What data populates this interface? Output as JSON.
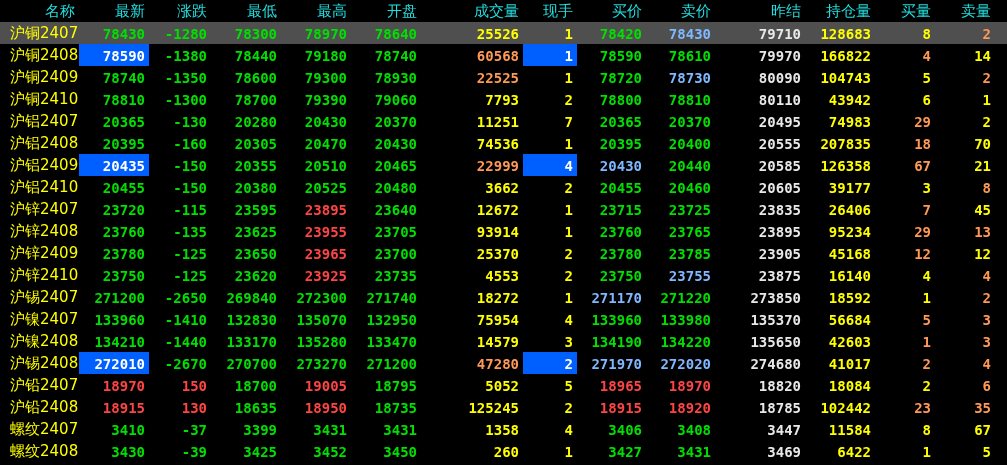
{
  "columns": [
    "名称",
    "最新",
    "涨跌",
    "最低",
    "最高",
    "开盘",
    "成交量",
    "现手",
    "买价",
    "卖价",
    "昨结",
    "持仓量",
    "买量",
    "卖量"
  ],
  "rows": [
    {
      "name": "沪铜2407",
      "selected": true,
      "flashed": false,
      "cells": [
        {
          "text": "78430",
          "color": "#00e000"
        },
        {
          "text": "-1280",
          "color": "#00e000"
        },
        {
          "text": "78300",
          "color": "#00e000"
        },
        {
          "text": "78970",
          "color": "#00e000"
        },
        {
          "text": "78640",
          "color": "#00e000"
        },
        {
          "text": "25526",
          "color": "#ffff00"
        },
        {
          "text": "1",
          "color": "#ffff00"
        },
        {
          "text": "78420",
          "color": "#00e000"
        },
        {
          "text": "78430",
          "color": "#80b8ff"
        },
        {
          "text": "79710",
          "color": "#e8e8e8"
        },
        {
          "text": "128683",
          "color": "#ffff00"
        },
        {
          "text": "8",
          "color": "#ffff00"
        },
        {
          "text": "2",
          "color": "#ff9955"
        }
      ]
    },
    {
      "name": "沪铜2408",
      "selected": false,
      "flashed": true,
      "cells": [
        {
          "text": "78590",
          "color": "#ffffff"
        },
        {
          "text": "-1380",
          "color": "#00e000"
        },
        {
          "text": "78440",
          "color": "#00e000"
        },
        {
          "text": "79180",
          "color": "#00e000"
        },
        {
          "text": "78740",
          "color": "#00e000"
        },
        {
          "text": "60568",
          "color": "#ff9955"
        },
        {
          "text": "1",
          "color": "#ffffff"
        },
        {
          "text": "78590",
          "color": "#00e000"
        },
        {
          "text": "78610",
          "color": "#00e000"
        },
        {
          "text": "79970",
          "color": "#e8e8e8"
        },
        {
          "text": "166822",
          "color": "#ffff00"
        },
        {
          "text": "4",
          "color": "#ff9955"
        },
        {
          "text": "14",
          "color": "#ffff00"
        }
      ]
    },
    {
      "name": "沪铜2409",
      "selected": false,
      "flashed": false,
      "cells": [
        {
          "text": "78740",
          "color": "#00e000"
        },
        {
          "text": "-1350",
          "color": "#00e000"
        },
        {
          "text": "78600",
          "color": "#00e000"
        },
        {
          "text": "79300",
          "color": "#00e000"
        },
        {
          "text": "78930",
          "color": "#00e000"
        },
        {
          "text": "22525",
          "color": "#ff9955"
        },
        {
          "text": "1",
          "color": "#ffff00"
        },
        {
          "text": "78720",
          "color": "#00e000"
        },
        {
          "text": "78730",
          "color": "#80b8ff"
        },
        {
          "text": "80090",
          "color": "#e8e8e8"
        },
        {
          "text": "104743",
          "color": "#ffff00"
        },
        {
          "text": "5",
          "color": "#ffff00"
        },
        {
          "text": "2",
          "color": "#ff9955"
        }
      ]
    },
    {
      "name": "沪铜2410",
      "selected": false,
      "flashed": false,
      "cells": [
        {
          "text": "78810",
          "color": "#00e000"
        },
        {
          "text": "-1300",
          "color": "#00e000"
        },
        {
          "text": "78700",
          "color": "#00e000"
        },
        {
          "text": "79390",
          "color": "#00e000"
        },
        {
          "text": "79060",
          "color": "#00e000"
        },
        {
          "text": "7793",
          "color": "#ffff00"
        },
        {
          "text": "2",
          "color": "#ffff00"
        },
        {
          "text": "78800",
          "color": "#00e000"
        },
        {
          "text": "78810",
          "color": "#00e000"
        },
        {
          "text": "80110",
          "color": "#e8e8e8"
        },
        {
          "text": "43942",
          "color": "#ffff00"
        },
        {
          "text": "6",
          "color": "#ffff00"
        },
        {
          "text": "1",
          "color": "#ffff00"
        }
      ]
    },
    {
      "name": "沪铝2407",
      "selected": false,
      "flashed": false,
      "cells": [
        {
          "text": "20365",
          "color": "#00e000"
        },
        {
          "text": "-130",
          "color": "#00e000"
        },
        {
          "text": "20280",
          "color": "#00e000"
        },
        {
          "text": "20430",
          "color": "#00e000"
        },
        {
          "text": "20370",
          "color": "#00e000"
        },
        {
          "text": "11251",
          "color": "#ffff00"
        },
        {
          "text": "7",
          "color": "#ffff00"
        },
        {
          "text": "20365",
          "color": "#00e000"
        },
        {
          "text": "20370",
          "color": "#00e000"
        },
        {
          "text": "20495",
          "color": "#e8e8e8"
        },
        {
          "text": "74983",
          "color": "#ffff00"
        },
        {
          "text": "29",
          "color": "#ff9955"
        },
        {
          "text": "2",
          "color": "#ffff00"
        }
      ]
    },
    {
      "name": "沪铝2408",
      "selected": false,
      "flashed": false,
      "cells": [
        {
          "text": "20395",
          "color": "#00e000"
        },
        {
          "text": "-160",
          "color": "#00e000"
        },
        {
          "text": "20305",
          "color": "#00e000"
        },
        {
          "text": "20470",
          "color": "#00e000"
        },
        {
          "text": "20430",
          "color": "#00e000"
        },
        {
          "text": "74536",
          "color": "#ffff00"
        },
        {
          "text": "1",
          "color": "#ffff00"
        },
        {
          "text": "20395",
          "color": "#00e000"
        },
        {
          "text": "20400",
          "color": "#00e000"
        },
        {
          "text": "20555",
          "color": "#e8e8e8"
        },
        {
          "text": "207835",
          "color": "#ffff00"
        },
        {
          "text": "18",
          "color": "#ff9955"
        },
        {
          "text": "70",
          "color": "#ffff00"
        }
      ]
    },
    {
      "name": "沪铝2409",
      "selected": false,
      "flashed": true,
      "cells": [
        {
          "text": "20435",
          "color": "#ffffff"
        },
        {
          "text": "-150",
          "color": "#00e000"
        },
        {
          "text": "20355",
          "color": "#00e000"
        },
        {
          "text": "20510",
          "color": "#00e000"
        },
        {
          "text": "20465",
          "color": "#00e000"
        },
        {
          "text": "22999",
          "color": "#ff9955"
        },
        {
          "text": "4",
          "color": "#ffffff"
        },
        {
          "text": "20430",
          "color": "#80b8ff"
        },
        {
          "text": "20440",
          "color": "#00e000"
        },
        {
          "text": "20585",
          "color": "#e8e8e8"
        },
        {
          "text": "126358",
          "color": "#ffff00"
        },
        {
          "text": "67",
          "color": "#ff9955"
        },
        {
          "text": "21",
          "color": "#ffff00"
        }
      ]
    },
    {
      "name": "沪铝2410",
      "selected": false,
      "flashed": false,
      "cells": [
        {
          "text": "20455",
          "color": "#00e000"
        },
        {
          "text": "-150",
          "color": "#00e000"
        },
        {
          "text": "20380",
          "color": "#00e000"
        },
        {
          "text": "20525",
          "color": "#00e000"
        },
        {
          "text": "20480",
          "color": "#00e000"
        },
        {
          "text": "3662",
          "color": "#ffff00"
        },
        {
          "text": "2",
          "color": "#ffff00"
        },
        {
          "text": "20455",
          "color": "#00e000"
        },
        {
          "text": "20460",
          "color": "#00e000"
        },
        {
          "text": "20605",
          "color": "#e8e8e8"
        },
        {
          "text": "39177",
          "color": "#ffff00"
        },
        {
          "text": "3",
          "color": "#ffff00"
        },
        {
          "text": "8",
          "color": "#ff9955"
        }
      ]
    },
    {
      "name": "沪锌2407",
      "selected": false,
      "flashed": false,
      "cells": [
        {
          "text": "23720",
          "color": "#00e000"
        },
        {
          "text": "-115",
          "color": "#00e000"
        },
        {
          "text": "23595",
          "color": "#00e000"
        },
        {
          "text": "23895",
          "color": "#ff4444"
        },
        {
          "text": "23640",
          "color": "#00e000"
        },
        {
          "text": "12672",
          "color": "#ffff00"
        },
        {
          "text": "1",
          "color": "#ffff00"
        },
        {
          "text": "23715",
          "color": "#00e000"
        },
        {
          "text": "23725",
          "color": "#00e000"
        },
        {
          "text": "23835",
          "color": "#e8e8e8"
        },
        {
          "text": "26406",
          "color": "#ffff00"
        },
        {
          "text": "7",
          "color": "#ff9955"
        },
        {
          "text": "45",
          "color": "#ffff00"
        }
      ]
    },
    {
      "name": "沪锌2408",
      "selected": false,
      "flashed": false,
      "cells": [
        {
          "text": "23760",
          "color": "#00e000"
        },
        {
          "text": "-135",
          "color": "#00e000"
        },
        {
          "text": "23625",
          "color": "#00e000"
        },
        {
          "text": "23955",
          "color": "#ff4444"
        },
        {
          "text": "23705",
          "color": "#00e000"
        },
        {
          "text": "93914",
          "color": "#ffff00"
        },
        {
          "text": "1",
          "color": "#ffff00"
        },
        {
          "text": "23760",
          "color": "#00e000"
        },
        {
          "text": "23765",
          "color": "#00e000"
        },
        {
          "text": "23895",
          "color": "#e8e8e8"
        },
        {
          "text": "95234",
          "color": "#ffff00"
        },
        {
          "text": "29",
          "color": "#ff9955"
        },
        {
          "text": "13",
          "color": "#ff9955"
        }
      ]
    },
    {
      "name": "沪锌2409",
      "selected": false,
      "flashed": false,
      "cells": [
        {
          "text": "23780",
          "color": "#00e000"
        },
        {
          "text": "-125",
          "color": "#00e000"
        },
        {
          "text": "23650",
          "color": "#00e000"
        },
        {
          "text": "23965",
          "color": "#ff4444"
        },
        {
          "text": "23700",
          "color": "#00e000"
        },
        {
          "text": "25370",
          "color": "#ffff00"
        },
        {
          "text": "2",
          "color": "#ffff00"
        },
        {
          "text": "23780",
          "color": "#00e000"
        },
        {
          "text": "23785",
          "color": "#00e000"
        },
        {
          "text": "23905",
          "color": "#e8e8e8"
        },
        {
          "text": "45168",
          "color": "#ffff00"
        },
        {
          "text": "12",
          "color": "#ff9955"
        },
        {
          "text": "12",
          "color": "#ffff00"
        }
      ]
    },
    {
      "name": "沪锌2410",
      "selected": false,
      "flashed": false,
      "cells": [
        {
          "text": "23750",
          "color": "#00e000"
        },
        {
          "text": "-125",
          "color": "#00e000"
        },
        {
          "text": "23620",
          "color": "#00e000"
        },
        {
          "text": "23925",
          "color": "#ff4444"
        },
        {
          "text": "23735",
          "color": "#00e000"
        },
        {
          "text": "4553",
          "color": "#ffff00"
        },
        {
          "text": "2",
          "color": "#ffff00"
        },
        {
          "text": "23750",
          "color": "#00e000"
        },
        {
          "text": "23755",
          "color": "#80b8ff"
        },
        {
          "text": "23875",
          "color": "#e8e8e8"
        },
        {
          "text": "16140",
          "color": "#ffff00"
        },
        {
          "text": "4",
          "color": "#ffff00"
        },
        {
          "text": "4",
          "color": "#ff9955"
        }
      ]
    },
    {
      "name": "沪锡2407",
      "selected": false,
      "flashed": false,
      "cells": [
        {
          "text": "271200",
          "color": "#00e000"
        },
        {
          "text": "-2650",
          "color": "#00e000"
        },
        {
          "text": "269840",
          "color": "#00e000"
        },
        {
          "text": "272300",
          "color": "#00e000"
        },
        {
          "text": "271740",
          "color": "#00e000"
        },
        {
          "text": "18272",
          "color": "#ffff00"
        },
        {
          "text": "1",
          "color": "#ffff00"
        },
        {
          "text": "271170",
          "color": "#80b8ff"
        },
        {
          "text": "271220",
          "color": "#00e000"
        },
        {
          "text": "273850",
          "color": "#e8e8e8"
        },
        {
          "text": "18592",
          "color": "#ffff00"
        },
        {
          "text": "1",
          "color": "#ffff00"
        },
        {
          "text": "2",
          "color": "#ff9955"
        }
      ]
    },
    {
      "name": "沪镍2407",
      "selected": false,
      "flashed": false,
      "cells": [
        {
          "text": "133960",
          "color": "#00e000"
        },
        {
          "text": "-1410",
          "color": "#00e000"
        },
        {
          "text": "132830",
          "color": "#00e000"
        },
        {
          "text": "135070",
          "color": "#00e000"
        },
        {
          "text": "132950",
          "color": "#00e000"
        },
        {
          "text": "75954",
          "color": "#ffff00"
        },
        {
          "text": "4",
          "color": "#ffff00"
        },
        {
          "text": "133960",
          "color": "#00e000"
        },
        {
          "text": "133980",
          "color": "#00e000"
        },
        {
          "text": "135370",
          "color": "#e8e8e8"
        },
        {
          "text": "56684",
          "color": "#ffff00"
        },
        {
          "text": "5",
          "color": "#ff9955"
        },
        {
          "text": "3",
          "color": "#ff9955"
        }
      ]
    },
    {
      "name": "沪镍2408",
      "selected": false,
      "flashed": false,
      "cells": [
        {
          "text": "134210",
          "color": "#00e000"
        },
        {
          "text": "-1440",
          "color": "#00e000"
        },
        {
          "text": "133170",
          "color": "#00e000"
        },
        {
          "text": "135280",
          "color": "#00e000"
        },
        {
          "text": "133470",
          "color": "#00e000"
        },
        {
          "text": "14579",
          "color": "#ffff00"
        },
        {
          "text": "3",
          "color": "#ffff00"
        },
        {
          "text": "134190",
          "color": "#00e000"
        },
        {
          "text": "134220",
          "color": "#00e000"
        },
        {
          "text": "135650",
          "color": "#e8e8e8"
        },
        {
          "text": "42603",
          "color": "#ffff00"
        },
        {
          "text": "1",
          "color": "#ff9955"
        },
        {
          "text": "3",
          "color": "#ff9955"
        }
      ]
    },
    {
      "name": "沪锡2408",
      "selected": false,
      "flashed": true,
      "cells": [
        {
          "text": "272010",
          "color": "#ffffff"
        },
        {
          "text": "-2670",
          "color": "#00e000"
        },
        {
          "text": "270700",
          "color": "#00e000"
        },
        {
          "text": "273270",
          "color": "#00e000"
        },
        {
          "text": "271200",
          "color": "#00e000"
        },
        {
          "text": "47280",
          "color": "#ff9955"
        },
        {
          "text": "2",
          "color": "#ffffff"
        },
        {
          "text": "271970",
          "color": "#80b8ff"
        },
        {
          "text": "272020",
          "color": "#80b8ff"
        },
        {
          "text": "274680",
          "color": "#e8e8e8"
        },
        {
          "text": "41017",
          "color": "#ffff00"
        },
        {
          "text": "2",
          "color": "#ff9955"
        },
        {
          "text": "4",
          "color": "#ff9955"
        }
      ]
    },
    {
      "name": "沪铅2407",
      "selected": false,
      "flashed": false,
      "cells": [
        {
          "text": "18970",
          "color": "#ff4444"
        },
        {
          "text": "150",
          "color": "#ff4444"
        },
        {
          "text": "18700",
          "color": "#00e000"
        },
        {
          "text": "19005",
          "color": "#ff4444"
        },
        {
          "text": "18795",
          "color": "#00e000"
        },
        {
          "text": "5052",
          "color": "#ffff00"
        },
        {
          "text": "5",
          "color": "#ffff00"
        },
        {
          "text": "18965",
          "color": "#ff4444"
        },
        {
          "text": "18970",
          "color": "#ff4444"
        },
        {
          "text": "18820",
          "color": "#e8e8e8"
        },
        {
          "text": "18084",
          "color": "#ffff00"
        },
        {
          "text": "2",
          "color": "#ffff00"
        },
        {
          "text": "6",
          "color": "#ff9955"
        }
      ]
    },
    {
      "name": "沪铅2408",
      "selected": false,
      "flashed": false,
      "cells": [
        {
          "text": "18915",
          "color": "#ff4444"
        },
        {
          "text": "130",
          "color": "#ff4444"
        },
        {
          "text": "18635",
          "color": "#00e000"
        },
        {
          "text": "18950",
          "color": "#ff4444"
        },
        {
          "text": "18735",
          "color": "#00e000"
        },
        {
          "text": "125245",
          "color": "#ffff00"
        },
        {
          "text": "2",
          "color": "#ffff00"
        },
        {
          "text": "18915",
          "color": "#ff4444"
        },
        {
          "text": "18920",
          "color": "#ff4444"
        },
        {
          "text": "18785",
          "color": "#e8e8e8"
        },
        {
          "text": "102442",
          "color": "#ffff00"
        },
        {
          "text": "23",
          "color": "#ff9955"
        },
        {
          "text": "35",
          "color": "#ff9955"
        }
      ]
    },
    {
      "name": "螺纹2407",
      "selected": false,
      "flashed": false,
      "cells": [
        {
          "text": "3410",
          "color": "#00e000"
        },
        {
          "text": "-37",
          "color": "#00e000"
        },
        {
          "text": "3399",
          "color": "#00e000"
        },
        {
          "text": "3431",
          "color": "#00e000"
        },
        {
          "text": "3431",
          "color": "#00e000"
        },
        {
          "text": "1358",
          "color": "#ffff00"
        },
        {
          "text": "4",
          "color": "#ffff00"
        },
        {
          "text": "3406",
          "color": "#00e000"
        },
        {
          "text": "3408",
          "color": "#00e000"
        },
        {
          "text": "3447",
          "color": "#e8e8e8"
        },
        {
          "text": "11584",
          "color": "#ffff00"
        },
        {
          "text": "8",
          "color": "#ffff00"
        },
        {
          "text": "67",
          "color": "#ffff00"
        }
      ]
    },
    {
      "name": "螺纹2408",
      "selected": false,
      "flashed": false,
      "cells": [
        {
          "text": "3430",
          "color": "#00e000"
        },
        {
          "text": "-39",
          "color": "#00e000"
        },
        {
          "text": "3425",
          "color": "#00e000"
        },
        {
          "text": "3452",
          "color": "#00e000"
        },
        {
          "text": "3450",
          "color": "#00e000"
        },
        {
          "text": "260",
          "color": "#ffff00"
        },
        {
          "text": "1",
          "color": "#ffff00"
        },
        {
          "text": "3427",
          "color": "#00e000"
        },
        {
          "text": "3431",
          "color": "#00e000"
        },
        {
          "text": "3469",
          "color": "#e8e8e8"
        },
        {
          "text": "6422",
          "color": "#ffff00"
        },
        {
          "text": "1",
          "color": "#ffff00"
        },
        {
          "text": "5",
          "color": "#ffff00"
        }
      ]
    }
  ]
}
